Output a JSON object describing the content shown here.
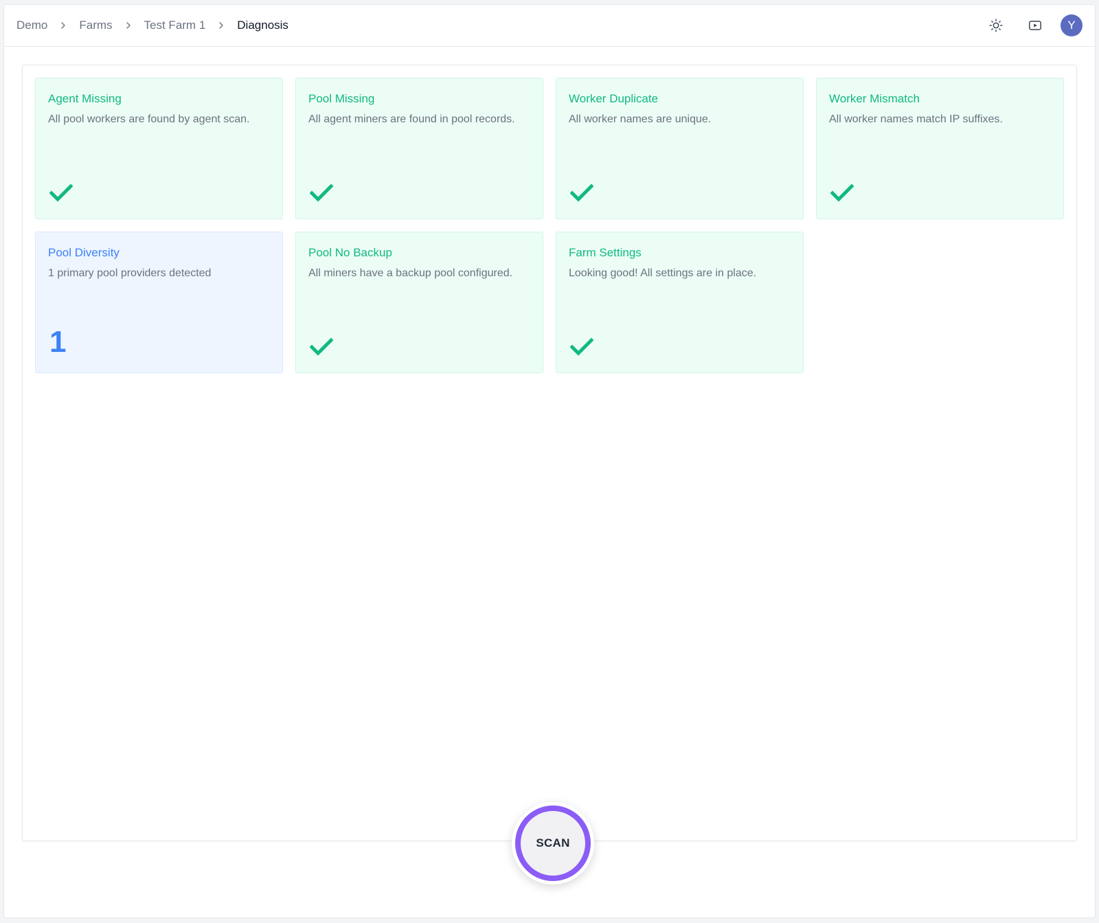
{
  "breadcrumb": {
    "items": [
      "Demo",
      "Farms",
      "Test Farm 1"
    ],
    "current": "Diagnosis"
  },
  "header": {
    "avatar_initial": "Y"
  },
  "cards": [
    {
      "title": "Agent Missing",
      "description": "All pool workers are found by agent scan.",
      "status": "ok"
    },
    {
      "title": "Pool Missing",
      "description": "All agent miners are found in pool records.",
      "status": "ok"
    },
    {
      "title": "Worker Duplicate",
      "description": "All worker names are unique.",
      "status": "ok"
    },
    {
      "title": "Worker Mismatch",
      "description": "All worker names match IP suffixes.",
      "status": "ok"
    },
    {
      "title": "Pool Diversity",
      "description": "1 primary pool providers detected",
      "status": "info",
      "value": "1"
    },
    {
      "title": "Pool No Backup",
      "description": "All miners have a backup pool configured.",
      "status": "ok"
    },
    {
      "title": "Farm Settings",
      "description": "Looking good! All settings are in place.",
      "status": "ok"
    }
  ],
  "scan": {
    "label": "SCAN"
  },
  "colors": {
    "ok": "#10b981",
    "info": "#3b82f6",
    "scan_ring": "#8b5cf6",
    "avatar": "#5b6bc0"
  }
}
